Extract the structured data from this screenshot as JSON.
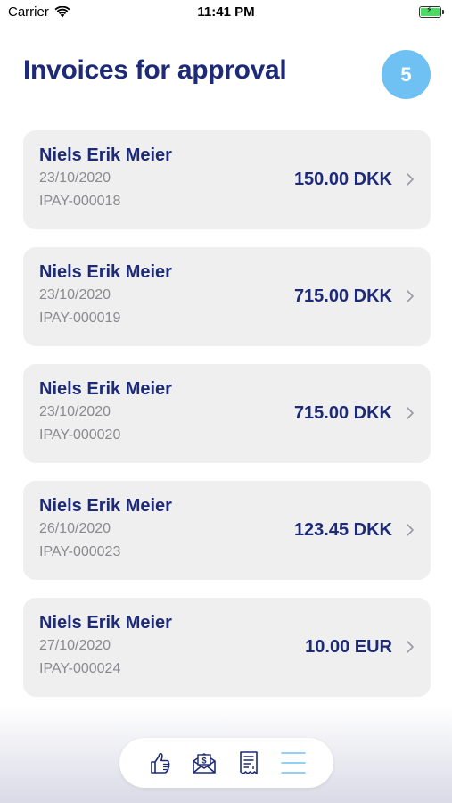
{
  "status_bar": {
    "carrier": "Carrier",
    "time": "11:41 PM"
  },
  "header": {
    "title": "Invoices for approval",
    "count": "5"
  },
  "invoices": [
    {
      "name": "Niels Erik Meier",
      "date": "23/10/2020",
      "id": "IPAY-000018",
      "amount": "150.00 DKK"
    },
    {
      "name": "Niels Erik Meier",
      "date": "23/10/2020",
      "id": "IPAY-000019",
      "amount": "715.00 DKK"
    },
    {
      "name": "Niels Erik Meier",
      "date": "23/10/2020",
      "id": "IPAY-000020",
      "amount": "715.00 DKK"
    },
    {
      "name": "Niels Erik Meier",
      "date": "26/10/2020",
      "id": "IPAY-000023",
      "amount": "123.45 DKK"
    },
    {
      "name": "Niels Erik Meier",
      "date": "27/10/2020",
      "id": "IPAY-000024",
      "amount": "10.00 EUR"
    }
  ],
  "tab_bar": {
    "tabs": [
      {
        "icon": "thumbs-up-icon"
      },
      {
        "icon": "money-envelope-icon"
      },
      {
        "icon": "receipt-icon"
      },
      {
        "icon": "menu-icon"
      }
    ]
  },
  "colors": {
    "primary": "#1c2a78",
    "accent": "#6ec1f2",
    "card": "#efeff0",
    "muted": "#8a8a8e"
  }
}
